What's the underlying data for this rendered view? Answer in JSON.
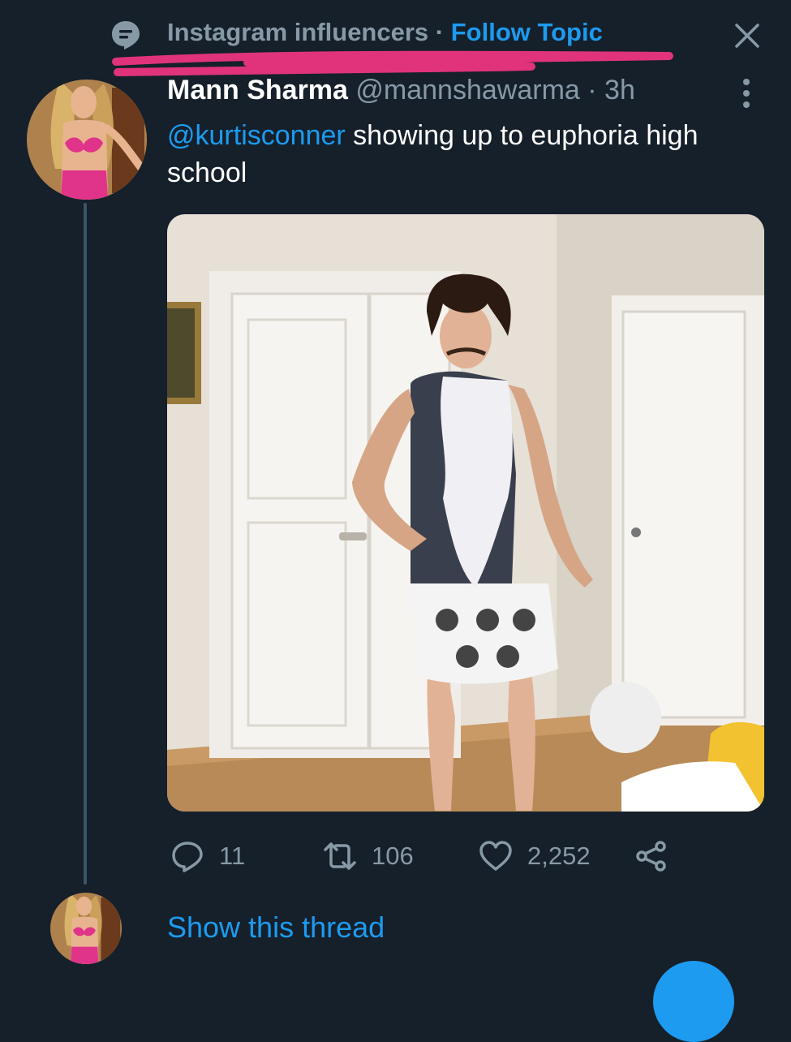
{
  "topic": {
    "name": "Instagram influencers",
    "separator": " · ",
    "follow_label": "Follow Topic"
  },
  "tweet": {
    "author_name": "Mann Sharma",
    "handle": "@mannshawarma",
    "meta_separator": " · ",
    "time": "3h",
    "mention": "@kurtisconner",
    "text": " showing up to euphoria high school",
    "replies": "11",
    "retweets": "106",
    "likes": "2,252"
  },
  "thread": {
    "show_label": "Show this thread"
  },
  "icons": {
    "topic": "topic-bubble-icon",
    "close": "close-icon",
    "more": "more-vertical-icon",
    "reply": "reply-icon",
    "retweet": "retweet-icon",
    "like": "heart-icon",
    "share": "share-icon"
  },
  "colors": {
    "background": "#15202b",
    "accent": "#1d9bf0",
    "muted": "#8899a6",
    "scribble": "#e0337c"
  }
}
